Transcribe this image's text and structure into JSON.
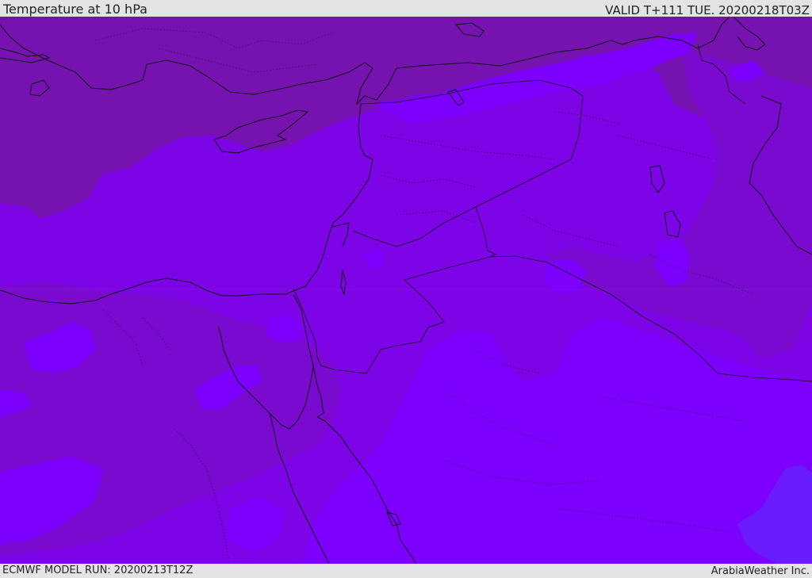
{
  "header": {
    "title": "Temperature at 10 hPa",
    "valid_time": "VALID T+111 TUE. 20200218T03Z"
  },
  "footer": {
    "model_run": "ECMWF MODEL RUN: 20200213T12Z",
    "credit": "ArabiaWeather Inc."
  },
  "map": {
    "fill_colors": {
      "darkest": "#7512b0",
      "dark": "#7a0ad0",
      "mid": "#7d04e6",
      "bright": "#7d00ff",
      "bluish": "#6a1cff"
    },
    "line_color": "#111111"
  }
}
